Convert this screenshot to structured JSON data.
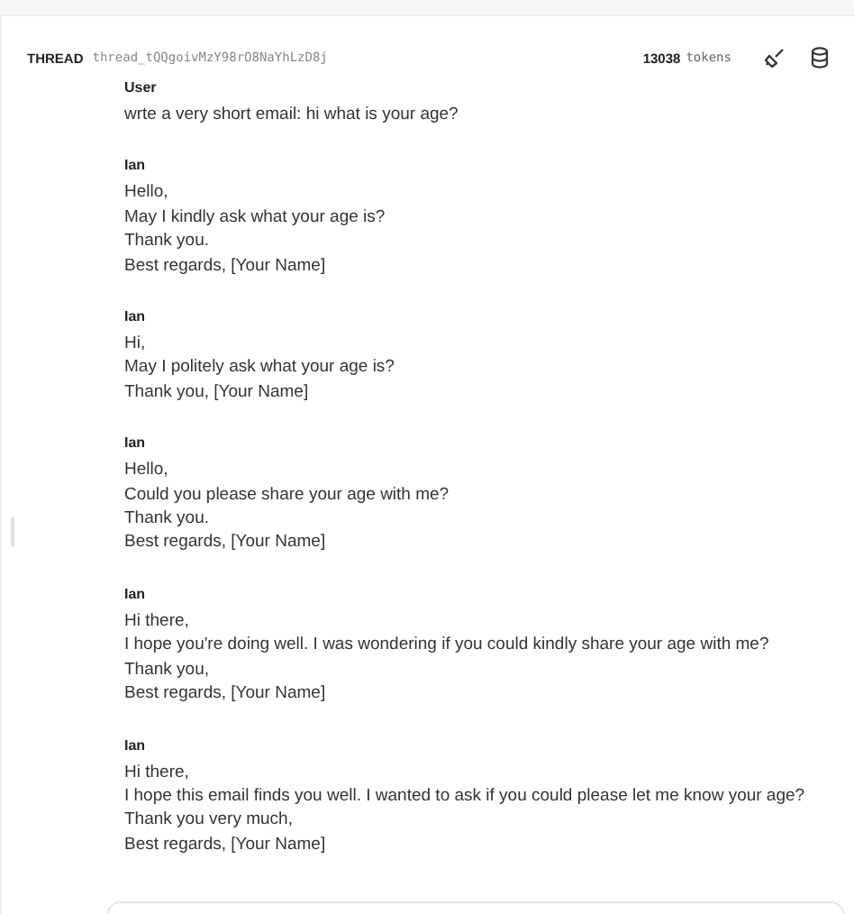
{
  "header": {
    "label": "THREAD",
    "thread_id": "thread_tQQgoivMzY98rO8NaYhLzD8j",
    "token_count": "13038",
    "token_unit": "tokens"
  },
  "messages": [
    {
      "role": "User",
      "lines": [
        "wrte a very short email: hi what is your age?"
      ]
    },
    {
      "role": "Ian",
      "lines": [
        "Hello,",
        "May I kindly ask what your age is?",
        "Thank you.",
        "Best regards, [Your Name]"
      ]
    },
    {
      "role": "Ian",
      "lines": [
        "Hi,",
        "May I politely ask what your age is?",
        "Thank you, [Your Name]"
      ]
    },
    {
      "role": "Ian",
      "lines": [
        "Hello,",
        "Could you please share your age with me?",
        "Thank you.",
        "Best regards, [Your Name]"
      ]
    },
    {
      "role": "Ian",
      "lines": [
        "Hi there,",
        "I hope you're doing well. I was wondering if you could kindly share your age with me?",
        "Thank you,",
        "Best regards, [Your Name]"
      ]
    },
    {
      "role": "Ian",
      "lines": [
        "Hi there,",
        "I hope this email finds you well. I wanted to ask if you could please let me know your age?",
        "Thank you very much,",
        "Best regards, [Your Name]"
      ]
    }
  ]
}
